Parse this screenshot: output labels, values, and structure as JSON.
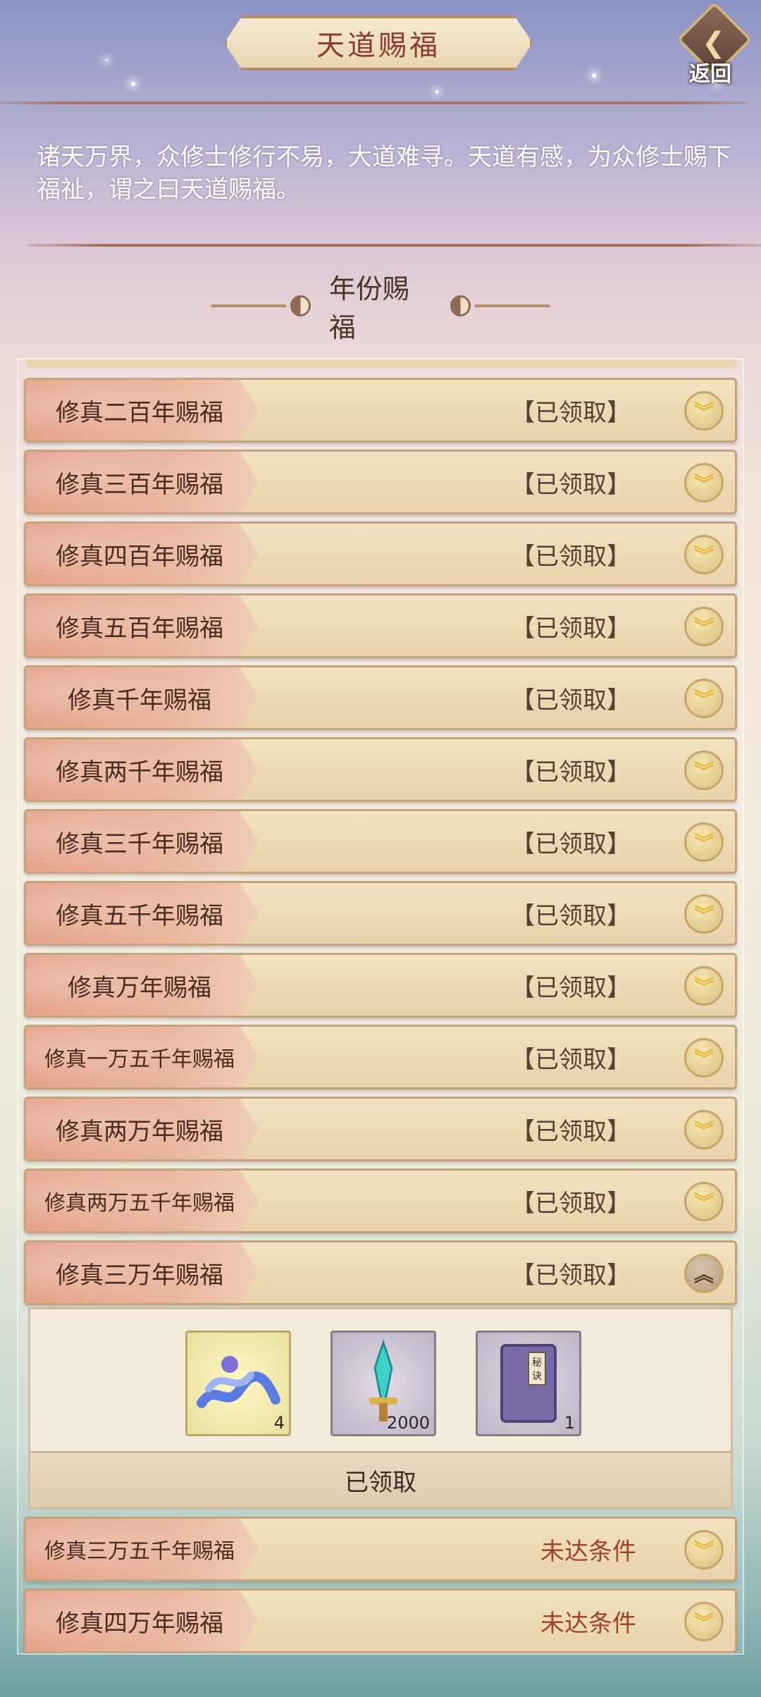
{
  "header": {
    "title": "天道赐福",
    "back_label": "返回"
  },
  "intro_text": "诸天万界，众修士修行不易，大道难寻。天道有感，为众修士赐下福祉，谓之曰天道赐福。",
  "section": {
    "title": "年份赐福"
  },
  "rows": [
    {
      "label": "修真二百年赐福",
      "status": "【已领取】",
      "state": "claimed"
    },
    {
      "label": "修真三百年赐福",
      "status": "【已领取】",
      "state": "claimed"
    },
    {
      "label": "修真四百年赐福",
      "status": "【已领取】",
      "state": "claimed"
    },
    {
      "label": "修真五百年赐福",
      "status": "【已领取】",
      "state": "claimed"
    },
    {
      "label": "修真千年赐福",
      "status": "【已领取】",
      "state": "claimed"
    },
    {
      "label": "修真两千年赐福",
      "status": "【已领取】",
      "state": "claimed"
    },
    {
      "label": "修真三千年赐福",
      "status": "【已领取】",
      "state": "claimed"
    },
    {
      "label": "修真五千年赐福",
      "status": "【已领取】",
      "state": "claimed"
    },
    {
      "label": "修真万年赐福",
      "status": "【已领取】",
      "state": "claimed"
    },
    {
      "label": "修真一万五千年赐福",
      "status": "【已领取】",
      "state": "claimed"
    },
    {
      "label": "修真两万年赐福",
      "status": "【已领取】",
      "state": "claimed"
    },
    {
      "label": "修真两万五千年赐福",
      "status": "【已领取】",
      "state": "claimed"
    },
    {
      "label": "修真三万年赐福",
      "status": "【已领取】",
      "state": "claimed",
      "expanded": true
    },
    {
      "label": "修真三万五千年赐福",
      "status": "未达条件",
      "state": "locked"
    },
    {
      "label": "修真四万年赐福",
      "status": "未达条件",
      "state": "locked"
    }
  ],
  "expanded_rewards": {
    "items": [
      {
        "icon": "water-wave-item-icon",
        "quantity": "4"
      },
      {
        "icon": "jade-sword-item-icon",
        "quantity": "2000"
      },
      {
        "icon": "secret-book-item-icon",
        "quantity": "1",
        "book_text": "秘诀"
      }
    ],
    "claimed_label": "已领取"
  },
  "colors": {
    "title_text": "#8a3d28",
    "pending_status": "#a0432a",
    "toggle_gold": "#e9b73c"
  }
}
